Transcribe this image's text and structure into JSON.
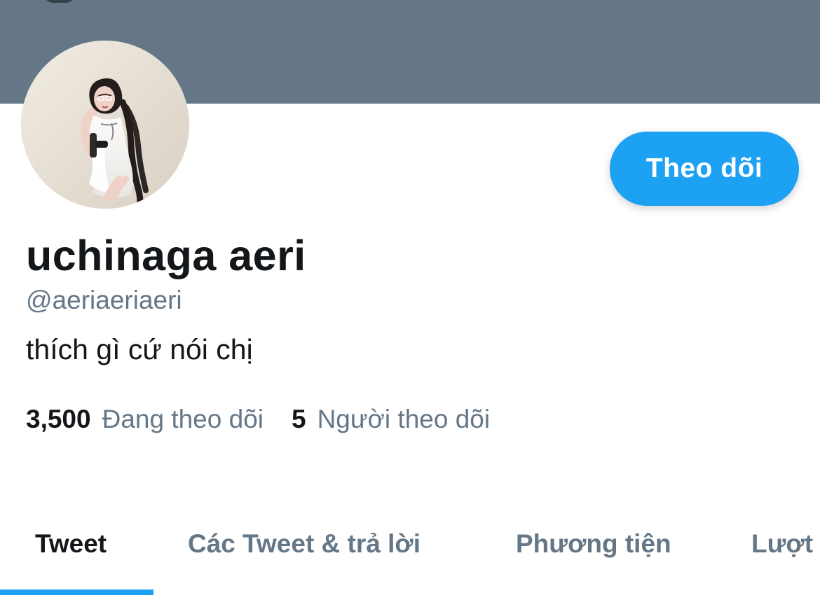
{
  "profile": {
    "display_name": "uchinaga aeri",
    "handle": "@aeriaeriaeri",
    "bio": "thích gì cứ nói chị"
  },
  "actions": {
    "follow_label": "Theo dõi"
  },
  "stats": {
    "following_count": "3,500",
    "following_label": "Đang theo dõi",
    "followers_count": "5",
    "followers_label": "Người theo dõi"
  },
  "tabs": [
    {
      "label": "Tweet",
      "active": true
    },
    {
      "label": "Các Tweet & trả lời",
      "active": false
    },
    {
      "label": "Phương tiện",
      "active": false
    },
    {
      "label": "Lượt",
      "active": false
    }
  ],
  "colors": {
    "banner": "#657786",
    "accent": "#1da1f2",
    "text_primary": "#14171a",
    "text_secondary": "#657786"
  },
  "icons": {
    "avatar": "profile-photo"
  }
}
